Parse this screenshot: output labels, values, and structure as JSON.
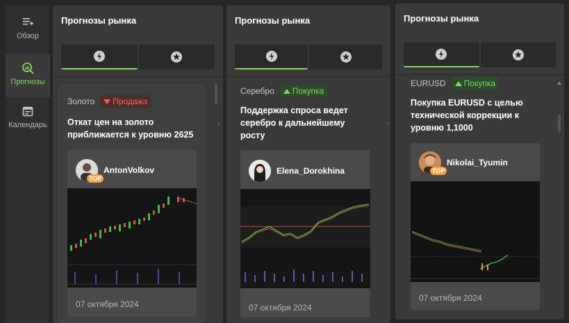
{
  "sidebar": {
    "items": [
      {
        "label": "Обзор",
        "icon": "list-add-icon"
      },
      {
        "label": "Прогнозы",
        "icon": "search-chart-icon",
        "active": true
      },
      {
        "label": "Календарь",
        "icon": "calendar-icon"
      }
    ]
  },
  "panels": [
    {
      "title": "Прогнозы рынка",
      "card": {
        "asset": "Золото",
        "badge": "Продажа",
        "badge_type": "sell",
        "headline_lines": [
          "Откат цен на золото",
          "приближается к уровню 2625"
        ],
        "author": "AntonVolkov",
        "top": "TOP",
        "date": "07 октября 2024"
      }
    },
    {
      "title": "Прогнозы рынка",
      "card": {
        "asset": "Серебро",
        "badge": "Покупка",
        "badge_type": "buy",
        "headline_lines": [
          "Поддержка спроса ведет",
          "серебро к дальнейшему",
          "росту"
        ],
        "author": "Elena_Dorokhina",
        "date": "07 октября 2024"
      }
    },
    {
      "title": "Прогнозы рынка",
      "card": {
        "asset": "EURUSD",
        "badge": "Покупка",
        "badge_type": "buy",
        "headline_lines": [
          "Покупка EURUSD с целью",
          "технической коррекции к",
          "уровню 1,1000"
        ],
        "author": "Nikolai_Tyumin",
        "top": "TOP",
        "date": "07 октября 2024"
      }
    }
  ],
  "colors": {
    "accent": "#7ed957",
    "sell": "#ff5a5a",
    "top_badge": "#f0a33b"
  }
}
